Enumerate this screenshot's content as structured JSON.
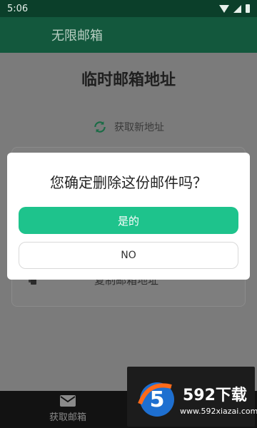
{
  "status_bar": {
    "time": "5:06"
  },
  "app_bar": {
    "title": "无限邮箱"
  },
  "main": {
    "page_title": "临时邮箱地址",
    "new_address_label": "获取新地址",
    "copy_address_label": "复制邮箱地址"
  },
  "dialog": {
    "message": "您确定删除这份邮件吗？",
    "yes_label": "是的",
    "no_label": "NO"
  },
  "bottom_nav": {
    "items": [
      {
        "label": "获取邮箱",
        "icon": "mail-icon"
      }
    ]
  },
  "watermark": {
    "brand": "592下载",
    "logo_digit": "5",
    "url": "www.592xiazai.com"
  },
  "colors": {
    "accent": "#1ec38c",
    "app_bar": "#13583d",
    "status_bar": "#0b3f2a"
  }
}
